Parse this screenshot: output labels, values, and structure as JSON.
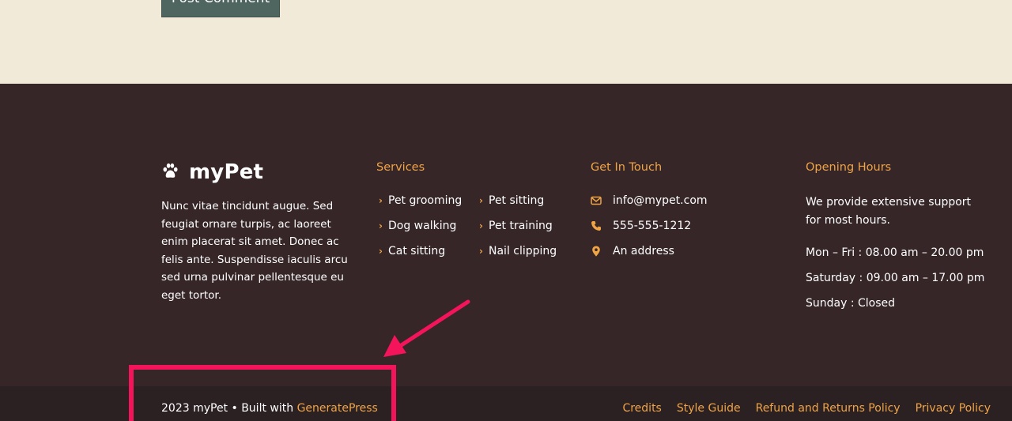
{
  "comment_form": {
    "submit_label": "Post Comment"
  },
  "brand": {
    "name": "myPet",
    "icon": "paw-icon"
  },
  "about_text": "Nunc vitae tincidunt augue. Sed feugiat ornare turpis, ac laoreet enim placerat sit amet. Donec ac felis ante. Suspendisse iaculis arcu sed urna pulvinar pellentesque eu eget tortor.",
  "services": {
    "title": "Services",
    "col1": [
      "Pet grooming",
      "Dog walking",
      "Cat sitting"
    ],
    "col2": [
      "Pet sitting",
      "Pet training",
      "Nail clipping"
    ]
  },
  "contact": {
    "title": "Get In Touch",
    "email": "info@mypet.com",
    "phone": "555-555-1212",
    "address": "An address"
  },
  "hours": {
    "title": "Opening Hours",
    "intro": "We provide extensive support for most hours.",
    "rows": [
      "Mon – Fri : 08.00 am – 20.00 pm",
      "Saturday : 09.00 am – 17.00 pm",
      "Sunday : Closed"
    ]
  },
  "site_info": {
    "copyright": "2023 myPet • Built with ",
    "theme_link": "GeneratePress",
    "nav": [
      "Credits",
      "Style Guide",
      "Refund and Returns Policy",
      "Privacy Policy"
    ]
  },
  "colors": {
    "accent": "#f0a445",
    "footer_bg": "#362628",
    "bottom_bg": "#2b2022",
    "page_bg": "#f2ead8",
    "highlight": "#f4145c"
  }
}
